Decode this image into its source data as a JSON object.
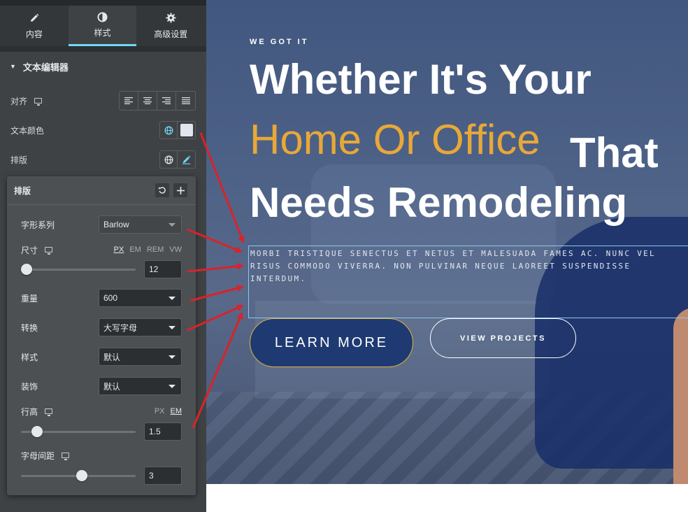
{
  "tabs": [
    {
      "label": "内容",
      "icon": "pencil-icon"
    },
    {
      "label": "样式",
      "icon": "half-circle-icon"
    },
    {
      "label": "高级设置",
      "icon": "gear-icon"
    }
  ],
  "section": {
    "title": "文本编辑器"
  },
  "controls": {
    "align_label": "对齐",
    "color_label": "文本颜色",
    "typography_label": "排版",
    "color_value": "#e4e4ef"
  },
  "typography": {
    "title": "排版",
    "font_family_label": "字形系列",
    "font_family_value": "Barlow",
    "size_label": "尺寸",
    "size_units": [
      "PX",
      "EM",
      "REM",
      "VW"
    ],
    "size_value": "12",
    "weight_label": "重量",
    "weight_value": "600",
    "transform_label": "转换",
    "transform_value": "大写字母",
    "style_label": "样式",
    "style_value": "默认",
    "decoration_label": "装饰",
    "decoration_value": "默认",
    "line_height_label": "行高",
    "line_height_units": [
      "PX",
      "EM"
    ],
    "line_height_value": "1.5",
    "letter_spacing_label": "字母间距",
    "letter_spacing_value": "3"
  },
  "hero": {
    "eyebrow": "WE GOT IT",
    "line1": "Whether It's Your",
    "line2": "Home Or Office",
    "line2b": "That",
    "line3": "Needs Remodeling",
    "body": "MORBI TRISTIQUE SENECTUS ET NETUS ET MALESUADA FAMES AC. NUNC VEL RISUS COMMODO VIVERRA. NON PULVINAR NEQUE LAOREET SUSPENDISSE INTERDUM.",
    "primary_button": "LEARN MORE",
    "secondary_button": "VIEW PROJECTS",
    "accent_color": "#e8a838",
    "button_color": "#1f3a72"
  }
}
